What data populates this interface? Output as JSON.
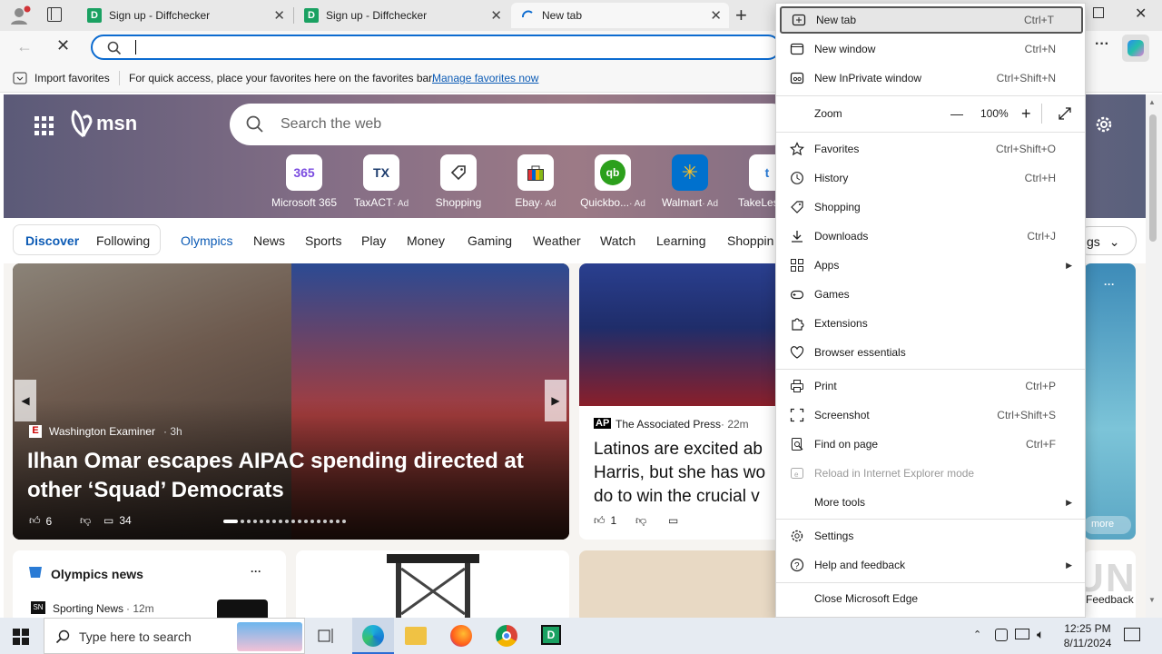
{
  "tabs": [
    {
      "title": "Sign up - Diffchecker",
      "close": "✕"
    },
    {
      "title": "Sign up - Diffchecker",
      "close": "✕"
    },
    {
      "title": "New tab",
      "close": "✕"
    }
  ],
  "new_tab_symbol": "+",
  "address": {
    "value": ""
  },
  "favorites_bar": {
    "import_label": "Import favorites",
    "hint": "For quick access, place your favorites here on the favorites bar.",
    "manage_link": "Manage favorites now"
  },
  "msn": {
    "logo": "msn",
    "search_placeholder": "Search the web",
    "quick_links": [
      {
        "label": "Microsoft 365",
        "ad": "",
        "icon": "365"
      },
      {
        "label": "TaxACT",
        "ad": "· Ad",
        "icon": "TX"
      },
      {
        "label": "Shopping",
        "ad": "",
        "icon": "tag"
      },
      {
        "label": "Ebay",
        "ad": "· Ad",
        "icon": "bag"
      },
      {
        "label": "Quickbo...",
        "ad": "· Ad",
        "icon": "qb"
      },
      {
        "label": "Walmart",
        "ad": "· Ad",
        "icon": "✳"
      },
      {
        "label": "TakeLes",
        "ad": "",
        "icon": "t"
      }
    ],
    "nav": [
      "Discover",
      "Following",
      "Olympics",
      "News",
      "Sports",
      "Play",
      "Money",
      "Gaming",
      "Weather",
      "Watch",
      "Learning",
      "Shoppin"
    ],
    "settings_pill": "gs",
    "main_story": {
      "source": "Washington Examiner",
      "age": "· 3h",
      "headline_1": "Ilhan Omar escapes AIPAC spending directed at",
      "headline_2": "other ‘Squad’ Democrats",
      "likes": "6",
      "comments": "34"
    },
    "second_story": {
      "source": "The Associated Press",
      "age": "· 22m",
      "headline_1": "Latinos are excited ab",
      "headline_2": "Harris, but she has wo",
      "headline_3": "do to win the crucial v",
      "likes": "1"
    },
    "olympics_card": {
      "title": "Olympics news",
      "source": "Sporting News",
      "age": "· 12m"
    },
    "more_pill": "more",
    "feedback": "Feedback"
  },
  "menu": {
    "items": [
      {
        "label": "New tab",
        "key": "Ctrl+T",
        "icon": "newtab"
      },
      {
        "label": "New window",
        "key": "Ctrl+N",
        "icon": "window"
      },
      {
        "label": "New InPrivate window",
        "key": "Ctrl+Shift+N",
        "icon": "inprivate"
      }
    ],
    "zoom": {
      "label": "Zoom",
      "minus": "—",
      "value": "100%",
      "plus": "+"
    },
    "items2": [
      {
        "label": "Favorites",
        "key": "Ctrl+Shift+O"
      },
      {
        "label": "History",
        "key": "Ctrl+H"
      },
      {
        "label": "Shopping",
        "key": ""
      },
      {
        "label": "Downloads",
        "key": "Ctrl+J"
      },
      {
        "label": "Apps",
        "key": ""
      },
      {
        "label": "Games",
        "key": ""
      },
      {
        "label": "Extensions",
        "key": ""
      },
      {
        "label": "Browser essentials",
        "key": ""
      }
    ],
    "items3": [
      {
        "label": "Print",
        "key": "Ctrl+P"
      },
      {
        "label": "Screenshot",
        "key": "Ctrl+Shift+S"
      },
      {
        "label": "Find on page",
        "key": "Ctrl+F"
      },
      {
        "label": "Reload in Internet Explorer mode",
        "key": ""
      },
      {
        "label": "More tools",
        "key": ""
      }
    ],
    "items4": [
      {
        "label": "Settings",
        "key": ""
      },
      {
        "label": "Help and feedback",
        "key": ""
      }
    ],
    "close_label": "Close Microsoft Edge",
    "submenu_arrow": "▶"
  },
  "taskbar": {
    "search_placeholder": "Type here to search",
    "time": "12:25 PM",
    "date": "8/11/2024"
  },
  "watermark": "ANY RUN"
}
